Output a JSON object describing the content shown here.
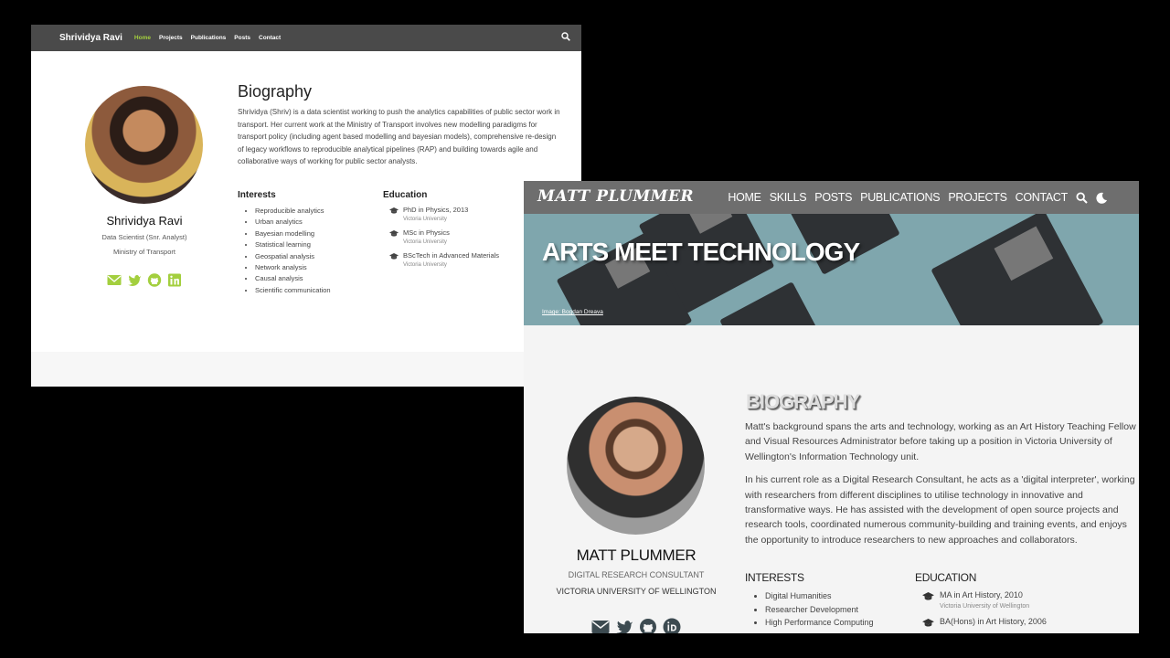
{
  "site1": {
    "brand": "Shrividya Ravi",
    "nav": [
      "Home",
      "Projects",
      "Publications",
      "Posts",
      "Contact"
    ],
    "active_nav": "Home",
    "profile": {
      "name": "Shrividya Ravi",
      "role": "Data Scientist (Snr. Analyst)",
      "org": "Ministry of Transport"
    },
    "biography_heading": "Biography",
    "biography": "Shrividya (Shriv) is a data scientist working to push the analytics capabilities of public sector work in transport. Her current work at the Ministry of Transport involves new modelling paradigms for transport policy (including agent based modelling and bayesian models), comprehensive re-design of legacy workflows to reproducible analytical pipelines (RAP) and building towards agile and collaborative ways of working for public sector analysts.",
    "interests_heading": "Interests",
    "interests": [
      "Reproducible analytics",
      "Urban analytics",
      "Bayesian modelling",
      "Statistical learning",
      "Geospatial analysis",
      "Network analysis",
      "Causal analysis",
      "Scientific communication"
    ],
    "education_heading": "Education",
    "education": [
      {
        "course": "PhD in Physics, 2013",
        "school": "Victoria University"
      },
      {
        "course": "MSc in Physics",
        "school": "Victoria University"
      },
      {
        "course": "BScTech in Advanced Materials",
        "school": "Victoria University"
      }
    ],
    "social_icons": [
      "email-icon",
      "twitter-icon",
      "github-icon",
      "linkedin-icon"
    ],
    "accent_color": "#a3cf3e"
  },
  "site2": {
    "brand": "MATT PLUMMER",
    "nav": [
      "HOME",
      "SKILLS",
      "POSTS",
      "PUBLICATIONS",
      "PROJECTS",
      "CONTACT"
    ],
    "hero_title": "ARTS MEET TECHNOLOGY",
    "hero_credit": "Image: Bogdan Dreava",
    "profile": {
      "name": "MATT PLUMMER",
      "role": "DIGITAL RESEARCH CONSULTANT",
      "org": "VICTORIA UNIVERSITY OF WELLINGTON"
    },
    "biography_heading": "BIOGRAPHY",
    "biography": [
      "Matt's background spans the arts and technology, working as an Art History Teaching Fellow and Visual Resources Administrator before taking up a position in Victoria University of Wellington's Information Technology unit.",
      "In his current role as a Digital Research Consultant, he acts as a 'digital interpreter', working with researchers from different disciplines to utilise technology in innovative and transformative ways. He has assisted with the development of open source projects and research tools, coordinated numerous community-building and training events, and enjoys the opportunity to introduce researchers to new approaches and collaborators."
    ],
    "interests_heading": "INTERESTS",
    "interests": [
      "Digital Humanities",
      "Researcher Development",
      "High Performance Computing"
    ],
    "education_heading": "EDUCATION",
    "education": [
      {
        "course": "MA in Art History, 2010",
        "school": "Victoria University of Wellington"
      },
      {
        "course": "BA(Hons) in Art History, 2006",
        "school": ""
      }
    ],
    "social_icons": [
      "email-icon",
      "twitter-icon",
      "github-icon",
      "orcid-icon"
    ],
    "icon_color": "#3c4a50"
  }
}
